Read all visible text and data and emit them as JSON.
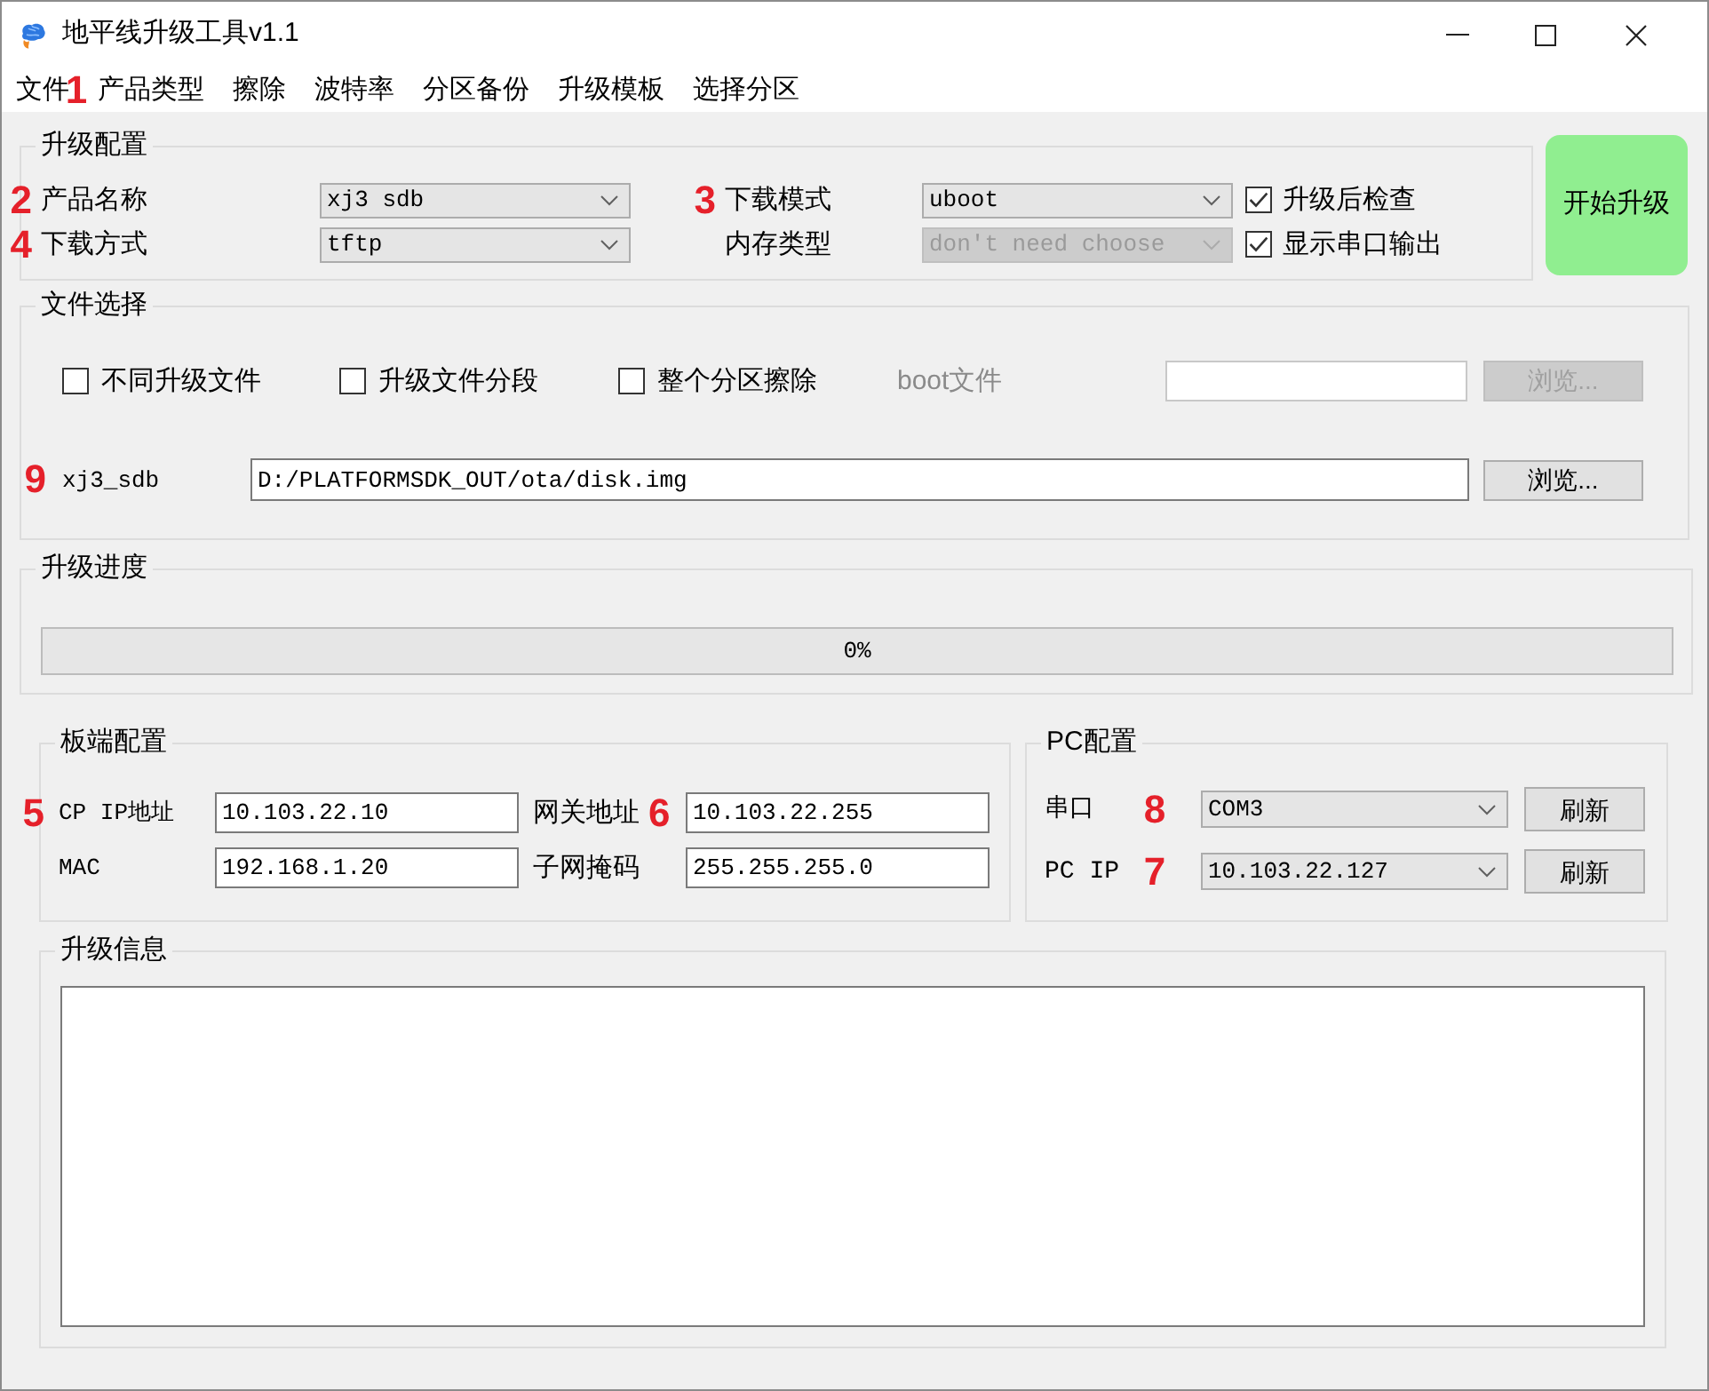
{
  "window": {
    "title": "地平线升级工具v1.1"
  },
  "menu": [
    {
      "label": "文件",
      "marker": "1"
    },
    {
      "label": "产品类型"
    },
    {
      "label": "擦除"
    },
    {
      "label": "波特率"
    },
    {
      "label": "分区备份"
    },
    {
      "label": "升级模板"
    },
    {
      "label": "选择分区"
    }
  ],
  "upgrade_config": {
    "title": "升级配置",
    "fields": [
      {
        "label": "产品名称",
        "marker": "2",
        "value": "xj3 sdb",
        "disabled": false
      },
      {
        "label": "下载模式",
        "marker": "3",
        "value": "uboot",
        "disabled": false
      },
      {
        "label": "下载方式",
        "marker": "4",
        "value": "tftp",
        "disabled": false
      },
      {
        "label": "内存类型",
        "value": "don't need choose",
        "disabled": true
      }
    ],
    "checkboxes": [
      {
        "label": "升级后检查",
        "checked": true
      },
      {
        "label": "显示串口输出",
        "checked": true
      }
    ]
  },
  "start_button": {
    "label": "开始升级"
  },
  "file_select": {
    "title": "文件选择",
    "options": [
      {
        "label": "不同升级文件",
        "checked": false
      },
      {
        "label": "升级文件分段",
        "checked": false
      },
      {
        "label": "整个分区擦除",
        "checked": false
      }
    ],
    "boot_file": {
      "label": "boot文件",
      "disabled": true,
      "button": "浏览..."
    },
    "image_file": {
      "label": "xj3_sdb",
      "marker": "9",
      "value": "D:/PLATFORMSDK_OUT/ota/disk.img",
      "button": "浏览..."
    }
  },
  "progress": {
    "title": "升级进度",
    "level": 0,
    "text": "0%"
  },
  "board_config": {
    "title": "板端配置",
    "fields": [
      {
        "label": "CP IP地址",
        "marker": "5",
        "value": "10.103.22.10"
      },
      {
        "label": "网关地址",
        "marker": "6",
        "value": "10.103.22.255"
      },
      {
        "label": "MAC",
        "value": "192.168.1.20"
      },
      {
        "label": "子网掩码",
        "value": "255.255.255.0"
      }
    ]
  },
  "pc_config": {
    "title": "PC配置",
    "rows": [
      {
        "label": "串口",
        "marker": "8",
        "value": "COM3",
        "button": "刷新"
      },
      {
        "label": "PC IP",
        "marker": "7",
        "value": "10.103.22.127",
        "button": "刷新"
      }
    ]
  },
  "log": {
    "title": "升级信息"
  }
}
